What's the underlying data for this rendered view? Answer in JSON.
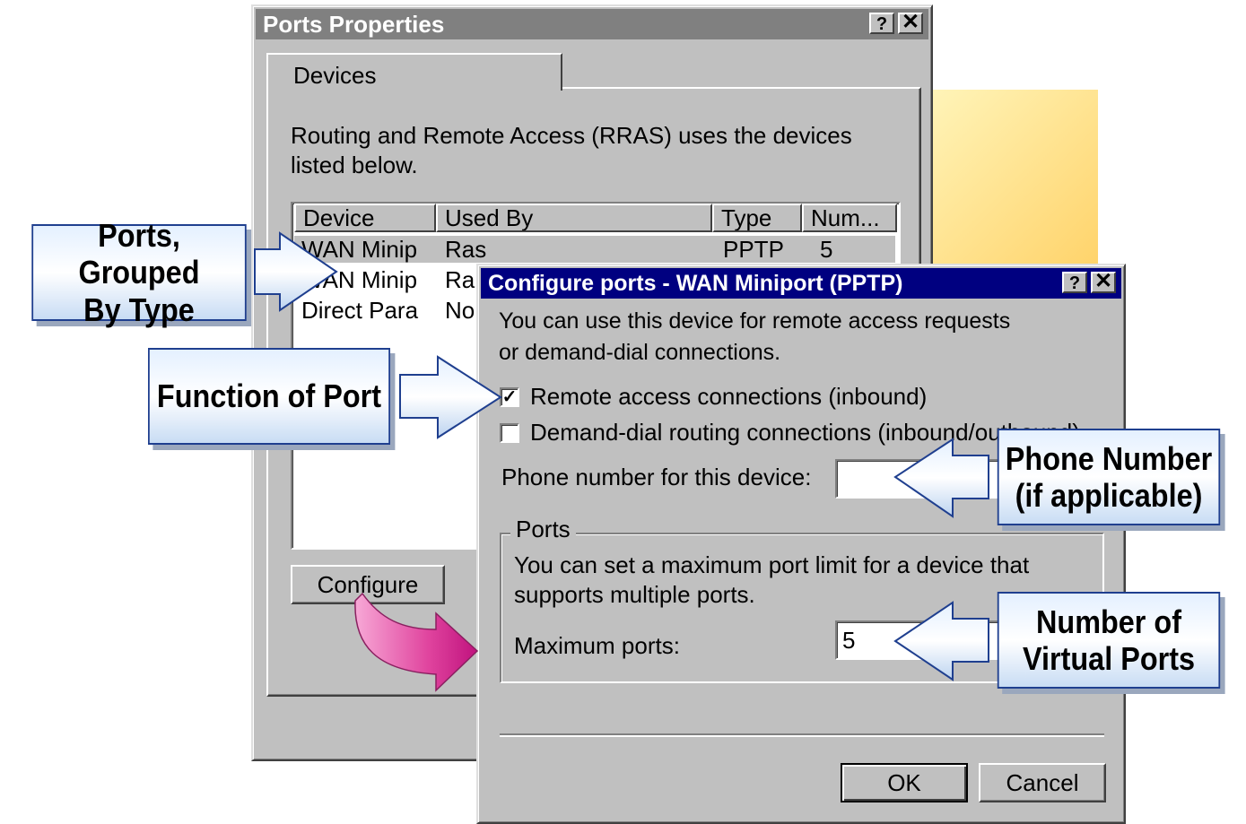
{
  "ports_properties": {
    "title": "Ports Properties",
    "help_label": "?",
    "close_label": "✕",
    "tab_devices": "Devices",
    "description": "Routing and Remote Access (RRAS) uses the devices listed below.",
    "columns": [
      "Device",
      "Used By",
      "Type",
      "Num..."
    ],
    "rows": [
      {
        "device": "WAN Minip",
        "used_by": "Ras",
        "type": "PPTP",
        "num": "5"
      },
      {
        "device": "WAN Minip",
        "used_by": "Ra",
        "type": "",
        "num": ""
      },
      {
        "device": "Direct Para",
        "used_by": "No",
        "type": "",
        "num": ""
      }
    ],
    "configure_label": "Configure"
  },
  "configure_ports": {
    "title": "Configure ports - WAN Miniport (PPTP)",
    "help_label": "?",
    "close_label": "✕",
    "intro_line1": "You can use this device for remote access requests",
    "intro_line2": "or demand-dial connections.",
    "remote_access_label": "Remote access connections (inbound)",
    "remote_access_checked": true,
    "demand_dial_label": "Demand-dial routing connections (inbound/outbound)",
    "demand_dial_checked": false,
    "phone_label": "Phone number for this device:",
    "phone_value": "",
    "ports_group_label": "Ports",
    "ports_desc_line1": "You can set a maximum port limit for a device that",
    "ports_desc_line2": "supports multiple ports.",
    "max_ports_label": "Maximum ports:",
    "max_ports_value": "5",
    "ok_label": "OK",
    "cancel_label": "Cancel"
  },
  "callouts": {
    "grouped_line1": "Ports, Grouped",
    "grouped_line2": "By Type",
    "function": "Function of Port",
    "phone_line1": "Phone Number",
    "phone_line2": "(if applicable)",
    "virtual_line1": "Number of",
    "virtual_line2": "Virtual Ports"
  },
  "colors": {
    "title_active": "#000080",
    "title_inactive": "#808080",
    "window_face": "#c0c0c0",
    "callout_border": "#1f3f8f",
    "pink_arrow": "#e0449e"
  }
}
